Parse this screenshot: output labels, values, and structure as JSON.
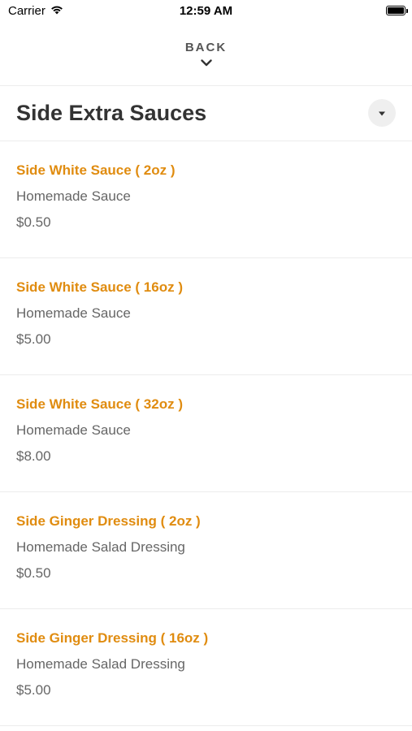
{
  "status_bar": {
    "carrier": "Carrier",
    "time": "12:59 AM",
    "wifi_icon": "wifi-icon",
    "battery_icon": "battery-icon"
  },
  "nav": {
    "back_label": "BACK",
    "back_icon": "chevron-down-icon"
  },
  "section": {
    "title": "Side Extra Sauces",
    "dropdown_icon": "caret-down-icon"
  },
  "items": [
    {
      "name": "Side White Sauce ( 2oz )",
      "description": "Homemade Sauce",
      "price": "$0.50"
    },
    {
      "name": "Side White Sauce ( 16oz )",
      "description": "Homemade Sauce",
      "price": "$5.00"
    },
    {
      "name": "Side White Sauce ( 32oz )",
      "description": "Homemade Sauce",
      "price": "$8.00"
    },
    {
      "name": "Side Ginger Dressing ( 2oz )",
      "description": "Homemade Salad Dressing",
      "price": "$0.50"
    },
    {
      "name": "Side Ginger Dressing ( 16oz )",
      "description": "Homemade Salad Dressing",
      "price": "$5.00"
    }
  ],
  "colors": {
    "accent": "#e08c10",
    "text_primary": "#333333",
    "text_secondary": "#666666",
    "divider": "#ececec"
  }
}
